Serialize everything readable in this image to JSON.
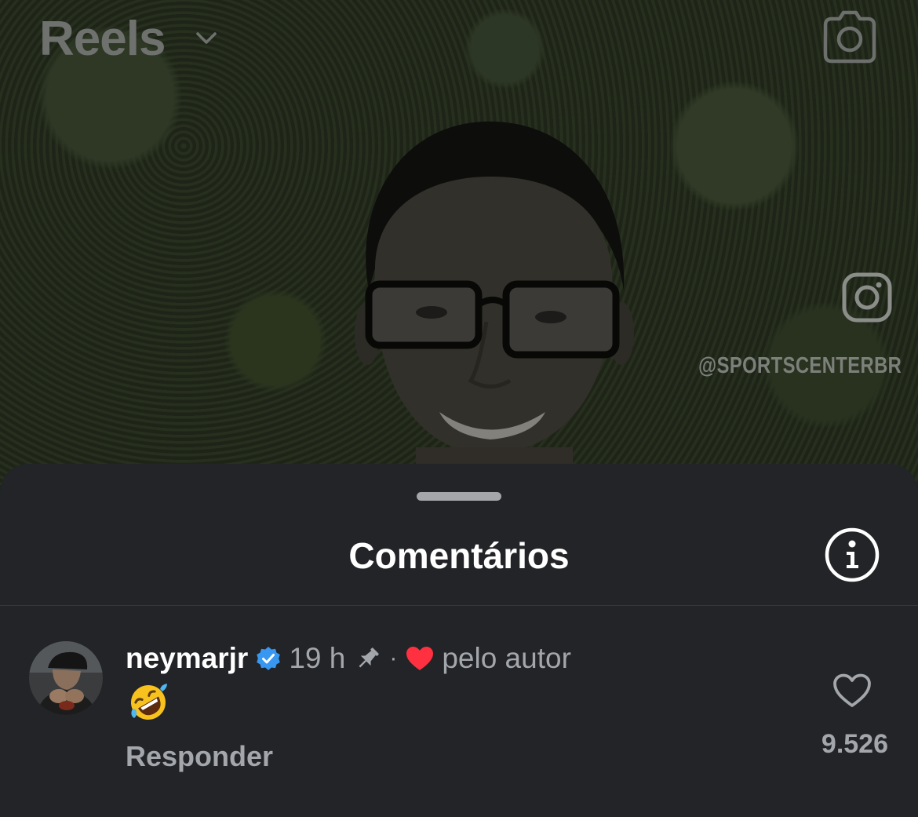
{
  "header": {
    "title": "Reels",
    "dropdown_icon": "chevron-down-icon",
    "camera_icon": "camera-icon"
  },
  "video": {
    "watermark_handle": "@SPORTSCENTERBR",
    "watermark_icon": "instagram-icon"
  },
  "comments_sheet": {
    "title": "Comentários",
    "info_icon": "info-icon",
    "comments": [
      {
        "username": "neymarjr",
        "verified": true,
        "time": "19 h",
        "pinned": true,
        "separator": "·",
        "liked_by_author_label": "pelo autor",
        "text_emoji": "rolling-on-the-floor-laughing-emoji",
        "reply_label": "Responder",
        "likes": "9.526"
      }
    ]
  },
  "colors": {
    "sheet_background": "#222427",
    "secondary_text": "#a3a6ab",
    "verified_blue": "#3897f0",
    "heart_red": "#ff3040"
  }
}
